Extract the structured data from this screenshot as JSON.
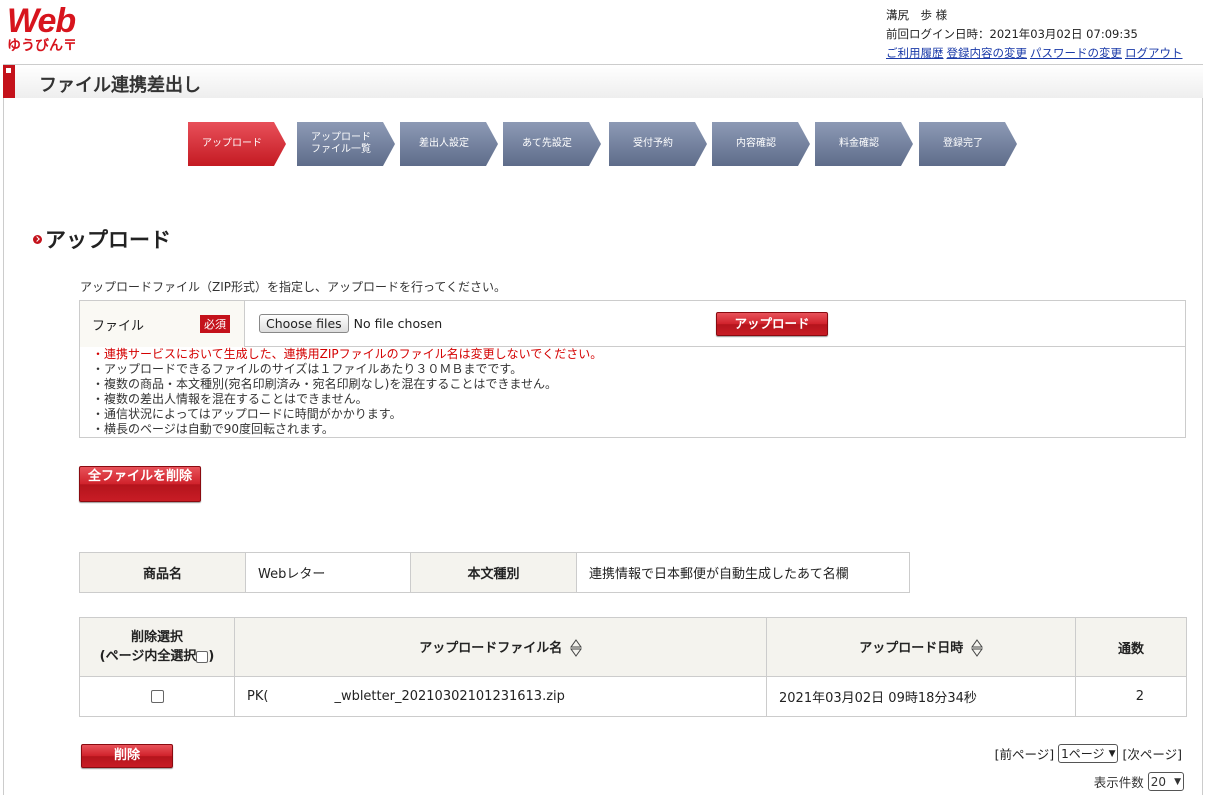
{
  "header": {
    "logo_main": "Web",
    "logo_sub": "ゆうびん〒",
    "user_name": "溝尻　歩 様",
    "last_login": "前回ログイン日時：2021年03月02日 07:09:35",
    "links": [
      "ご利用履歴",
      "登録内容の変更",
      "パスワードの変更",
      "ログアウト"
    ]
  },
  "page_title": "ファイル連携差出し",
  "steps": [
    {
      "label": "アップロード",
      "active": true
    },
    {
      "label": "アップロード\nファイル一覧",
      "active": false
    },
    {
      "label": "差出人設定",
      "active": false
    },
    {
      "label": "あて先設定",
      "active": false
    },
    {
      "label": "受付予約",
      "active": false
    },
    {
      "label": "内容確認",
      "active": false
    },
    {
      "label": "料金確認",
      "active": false
    },
    {
      "label": "登録完了",
      "active": false
    }
  ],
  "section": {
    "title": "アップロード",
    "description": "アップロードファイル（ZIP形式）を指定し、アップロードを行ってください。"
  },
  "upload": {
    "file_label": "ファイル",
    "required": "必須",
    "choose_button": "Choose files",
    "no_file": "No file chosen",
    "upload_button": "アップロード",
    "notes": [
      {
        "text": "・連携サービスにおいて生成した、連携用ZIPファイルのファイル名は変更しないでください。",
        "warn": true
      },
      {
        "text": "・アップロードできるファイルのサイズは１ファイルあたり３０ＭＢまでです。",
        "warn": false
      },
      {
        "text": "・複数の商品・本文種別(宛名印刷済み・宛名印刷なし)を混在することはできません。",
        "warn": false
      },
      {
        "text": "・複数の差出人情報を混在することはできません。",
        "warn": false
      },
      {
        "text": "・通信状況によってはアップロードに時間がかかります。",
        "warn": false
      },
      {
        "text": "・横長のページは自動で90度回転されます。",
        "warn": false
      }
    ]
  },
  "delete_all_button": "全ファイルを削除",
  "product_table": {
    "product_header": "商品名",
    "product_value": "Webレター",
    "type_header": "本文種別",
    "type_value": "連携情報で日本郵便が自動生成したあて名欄"
  },
  "file_table": {
    "headers": {
      "select": "削除選択",
      "select_sub": "(ページ内全選択",
      "select_sub_end": ")",
      "filename": "アップロードファイル名",
      "date": "アップロード日時",
      "count": "通数"
    },
    "rows": [
      {
        "filename_prefix": "PK(",
        "filename_suffix": "_wbletter_20210302101231613.zip",
        "date": "2021年03月02日 09時18分34秒",
        "count": "2"
      }
    ]
  },
  "delete_button": "削除",
  "pager": {
    "prev": "[前ページ]",
    "current_page": "1ページ",
    "next": "[次ページ]",
    "count_label": "表示件数",
    "count_value": "20"
  },
  "colors": {
    "accent_red": "#c4121b",
    "step_gray": "#6f7d99"
  }
}
